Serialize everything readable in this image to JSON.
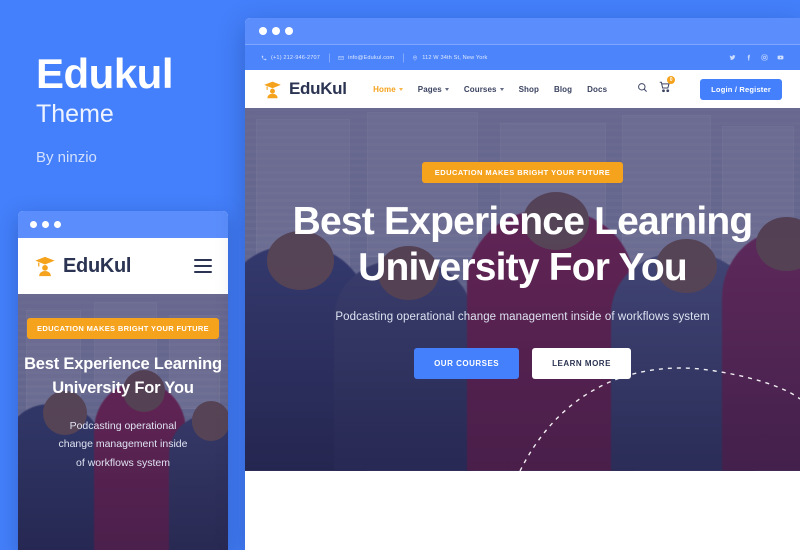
{
  "promo": {
    "title": "Edukul",
    "subtitle": "Theme",
    "author": "By ninzio",
    "background_color": "#4480fb"
  },
  "brand": {
    "name": "EduKul",
    "logo_icon": "graduation-cap-person-icon",
    "accent_color": "#f5a21d",
    "primary_color": "#4480fb",
    "dark_color": "#2b3452"
  },
  "desktop": {
    "topbar": {
      "contact": [
        {
          "icon": "phone-icon",
          "text": "(+1) 212-946-2707"
        },
        {
          "icon": "envelope-icon",
          "text": "info@Edukul.com"
        },
        {
          "icon": "map-pin-icon",
          "text": "112 W 34th St, New York"
        }
      ],
      "socials": [
        {
          "icon": "twitter-icon",
          "label": "Twitter"
        },
        {
          "icon": "facebook-icon",
          "label": "Facebook"
        },
        {
          "icon": "instagram-icon",
          "label": "Instagram"
        },
        {
          "icon": "youtube-icon",
          "label": "YouTube"
        }
      ]
    },
    "nav": {
      "items": [
        {
          "label": "Home",
          "has_dropdown": true,
          "active": true
        },
        {
          "label": "Pages",
          "has_dropdown": true,
          "active": false
        },
        {
          "label": "Courses",
          "has_dropdown": true,
          "active": false
        },
        {
          "label": "Shop",
          "has_dropdown": false,
          "active": false
        },
        {
          "label": "Blog",
          "has_dropdown": false,
          "active": false
        },
        {
          "label": "Docs",
          "has_dropdown": false,
          "active": false
        }
      ],
      "search_icon": "search-icon",
      "cart_icon": "shopping-cart-icon",
      "cart_count": "0",
      "login_label": "Login / Register"
    },
    "hero": {
      "badge": "EDUCATION MAKES BRIGHT YOUR FUTURE",
      "heading_line1": "Best Experience Learning",
      "heading_line2": "University For You",
      "subtitle": "Podcasting operational change management inside of workflows system",
      "primary_button": "OUR COURSES",
      "secondary_button": "LEARN MORE"
    }
  },
  "mobile": {
    "hero": {
      "badge": "EDUCATION MAKES BRIGHT YOUR FUTURE",
      "heading_line1": "Best Experience Learning",
      "heading_line2": "University For You",
      "subtitle_line1": "Podcasting operational",
      "subtitle_line2": "change management inside",
      "subtitle_line3": "of workflows system"
    },
    "menu_icon": "hamburger-menu-icon"
  }
}
